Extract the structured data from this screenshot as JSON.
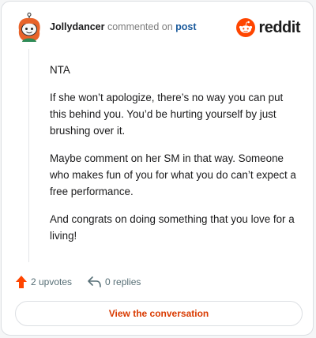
{
  "comment": {
    "username": "Jollydancer",
    "action_text": "commented on",
    "post_link_label": "post",
    "paragraphs": [
      "NTA",
      "If she won’t apologize, there’s no way you can put this behind you. You’d be hurting yourself by just brushing over it.",
      "Maybe comment on her SM in that way. Someone who makes fun of you for what you do can’t expect a free performance.",
      "And congrats on doing something that you love for a living!"
    ]
  },
  "brand": {
    "name": "reddit",
    "icon": "reddit-logo-icon",
    "color": "#ff4500"
  },
  "footer": {
    "upvotes_label": "2 upvotes",
    "replies_label": "0 replies",
    "upvote_icon": "upvote-arrow-icon",
    "reply_icon": "reply-arrow-icon",
    "cta_label": "View the conversation"
  },
  "colors": {
    "accent": "#d93a00",
    "upvote": "#ff4500",
    "link": "#1a5a9c"
  }
}
